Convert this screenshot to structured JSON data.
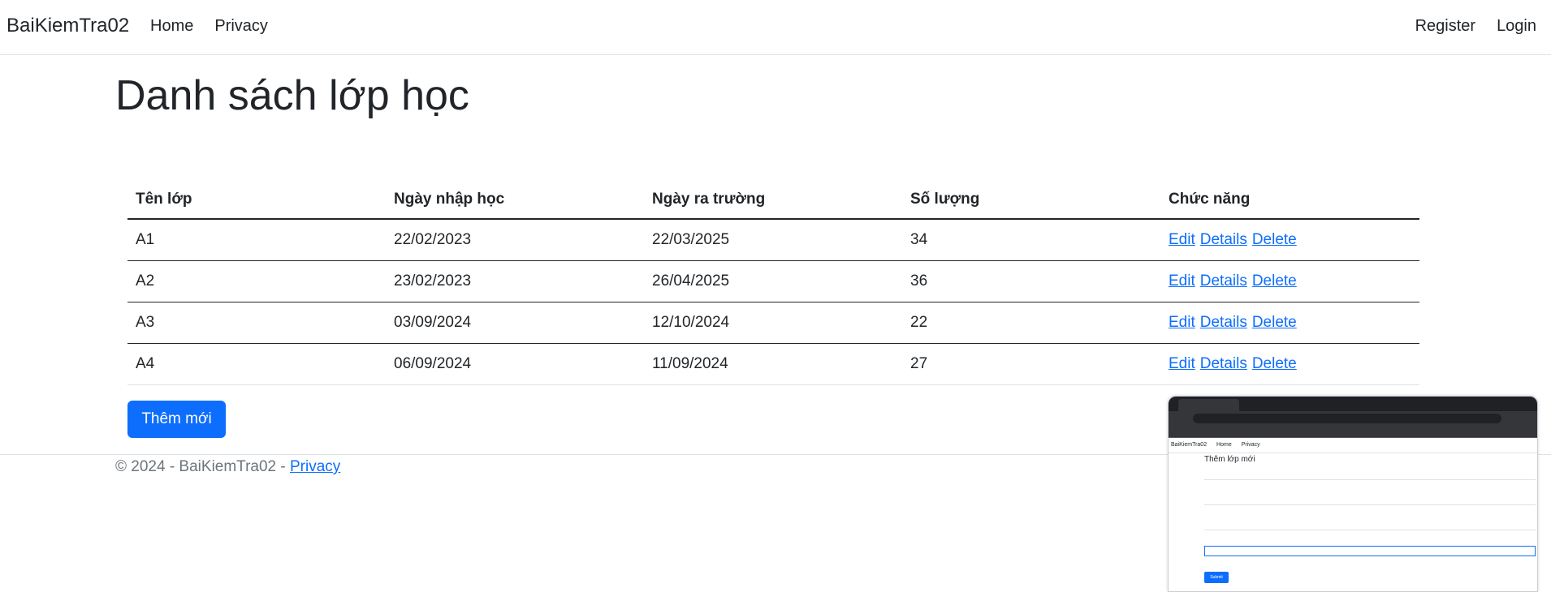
{
  "navbar": {
    "brand": "BaiKiemTra02",
    "links": [
      "Home",
      "Privacy"
    ],
    "right_links": [
      "Register",
      "Login"
    ]
  },
  "page": {
    "title": "Danh sách lớp học"
  },
  "table": {
    "headers": [
      "Tên lớp",
      "Ngày nhập học",
      "Ngày ra trường",
      "Số lượng",
      "Chức năng"
    ],
    "rows": [
      [
        "A1",
        "22/02/2023",
        "22/03/2025",
        "34"
      ],
      [
        "A2",
        "23/02/2023",
        "26/04/2025",
        "36"
      ],
      [
        "A3",
        "03/09/2024",
        "12/10/2024",
        "22"
      ],
      [
        "A4",
        "06/09/2024",
        "11/09/2024",
        "27"
      ]
    ],
    "actions": [
      "Edit",
      "Details",
      "Delete"
    ]
  },
  "add_button": "Thêm mới",
  "footer": {
    "text": "© 2024 - BaiKiemTra02 - ",
    "link": "Privacy"
  },
  "thumbnail": {
    "nav_brand": "BaiKiemTra02",
    "nav_links": [
      "Home",
      "Privacy"
    ],
    "form_title": "Thêm lớp mới",
    "submit": "Submit"
  },
  "colors": {
    "primary": "#0d6efd",
    "text": "#212529",
    "muted": "#6c757d"
  }
}
